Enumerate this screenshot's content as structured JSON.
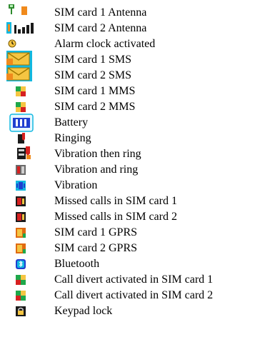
{
  "legend": {
    "items": [
      {
        "icon": "sim-antenna-icon",
        "label": "SIM card 1 Antenna"
      },
      {
        "icon": "sim-antenna-icon",
        "label": "SIM card 2 Antenna"
      },
      {
        "icon": "alarm-clock-icon",
        "label": "Alarm clock activated"
      },
      {
        "icon": "envelope-icon",
        "label": "SIM card 1 SMS"
      },
      {
        "icon": "envelope-icon",
        "label": "SIM card 2 SMS"
      },
      {
        "icon": "mms-icon",
        "label": "SIM card 1 MMS"
      },
      {
        "icon": "mms-icon",
        "label": "SIM card 2 MMS"
      },
      {
        "icon": "battery-icon",
        "label": "Battery"
      },
      {
        "icon": "ringing-icon",
        "label": "Ringing"
      },
      {
        "icon": "vibration-then-ring-icon",
        "label": "Vibration then ring"
      },
      {
        "icon": "vibration-and-ring-icon",
        "label": "Vibration and ring"
      },
      {
        "icon": "vibration-icon",
        "label": "Vibration"
      },
      {
        "icon": "missed-call-icon",
        "label": "Missed calls in SIM card 1"
      },
      {
        "icon": "missed-call-icon",
        "label": "Missed calls in SIM card 2"
      },
      {
        "icon": "gprs-icon",
        "label": "SIM card 1 GPRS"
      },
      {
        "icon": "gprs-icon",
        "label": "SIM card 2 GPRS"
      },
      {
        "icon": "bluetooth-icon",
        "label": "Bluetooth"
      },
      {
        "icon": "call-divert-icon",
        "label": "Call divert activated in SIM card 1"
      },
      {
        "icon": "call-divert-icon",
        "label": "Call divert activated in SIM card 2"
      },
      {
        "icon": "keypad-lock-icon",
        "label": "Keypad lock"
      }
    ]
  },
  "colors": {
    "antenna_green": "#2e8b2e",
    "antenna_blue": "#1a4fd6",
    "sim_badge_orange": "#f08a1c",
    "envelope_yellow": "#f5c542",
    "icon_cyan": "#12b8e0",
    "battery_blue": "#1f3fd0",
    "missed_call_red": "#d62020",
    "gprs_orange": "#e06a10",
    "divert_green": "#1fa84a"
  }
}
